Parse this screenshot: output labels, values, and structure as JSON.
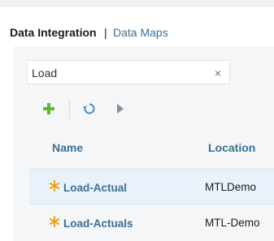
{
  "header": {
    "title": "Data Integration",
    "separator": "|",
    "breadcrumb": "Data Maps"
  },
  "search": {
    "value": "Load",
    "clear_icon": "×"
  },
  "toolbar": {
    "add_icon": "plus-icon",
    "refresh_icon": "refresh-icon",
    "run_icon": "play-icon"
  },
  "table": {
    "columns": [
      "Name",
      "Location"
    ],
    "rows": [
      {
        "name": "Load-Actual",
        "location": "MTLDemo",
        "selected": true
      },
      {
        "name": "Load-Actuals",
        "location": "MTL-Demo",
        "selected": false
      }
    ]
  },
  "colors": {
    "link": "#3f6f91",
    "add_green": "#5cb82e",
    "refresh_blue": "#4a90c8",
    "star_gold": "#e8a317",
    "selected_row": "#e9f2fb"
  }
}
